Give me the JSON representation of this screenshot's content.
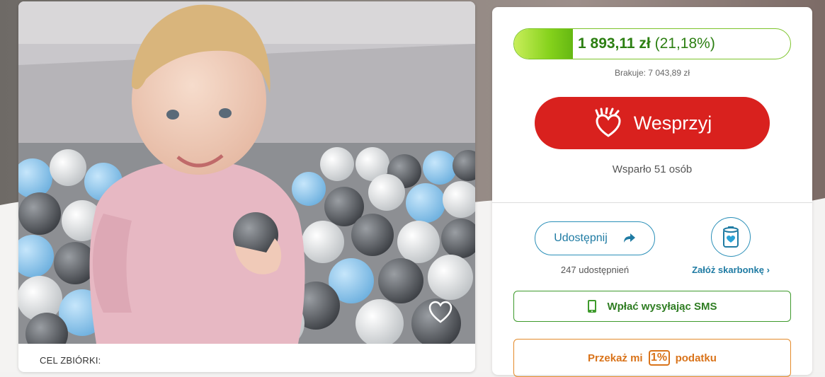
{
  "campaign": {
    "goal_label": "CEL ZBIÓRKI:"
  },
  "donation": {
    "amount": "1 893,11 zł",
    "percent_text": "(21,18%)",
    "progress_fraction": 0.2118,
    "missing": "Brakuje: 7 043,89 zł",
    "support_label": "Wesprzyj",
    "supporters": "Wsparło 51 osób"
  },
  "share": {
    "label": "Udostępnij",
    "count": "247 udostępnień"
  },
  "piggybank": {
    "link": "Załóż skarbonkę ›"
  },
  "sms": {
    "label": "Wpłać wysyłając SMS"
  },
  "tax": {
    "prefix": "Przekaż mi",
    "pct": "1%",
    "suffix": "podatku"
  },
  "colors": {
    "accent_red": "#d9211e",
    "progress_green": "#86d21c",
    "link_blue": "#1f7ba3",
    "sms_green": "#2f7d22",
    "tax_orange": "#d9731a"
  },
  "icons": [
    "heart-hand-icon",
    "share-arrow-icon",
    "piggybank-icon",
    "phone-icon",
    "favorite-heart-icon"
  ]
}
